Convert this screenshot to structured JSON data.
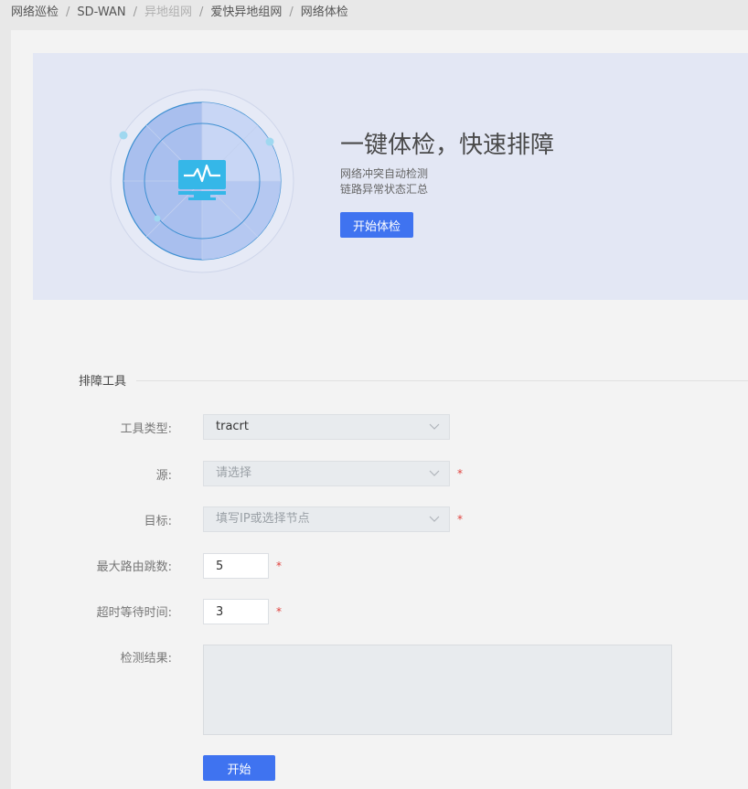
{
  "breadcrumb": [
    {
      "label": "网络巡检",
      "disabled": false
    },
    {
      "label": "SD-WAN",
      "disabled": false
    },
    {
      "label": "异地组网",
      "disabled": true
    },
    {
      "label": "爱快异地组网",
      "disabled": false
    },
    {
      "label": "网络体检",
      "disabled": false
    }
  ],
  "hero": {
    "title": "一键体检，快速排障",
    "line1": "网络冲突自动检测",
    "line2": "链路异常状态汇总",
    "button": "开始体检"
  },
  "tools": {
    "section_title": "排障工具",
    "tool_type": {
      "label": "工具类型:",
      "value": "tracrt"
    },
    "source": {
      "label": "源:",
      "placeholder": "请选择",
      "required": "*"
    },
    "target": {
      "label": "目标:",
      "placeholder": "填写IP或选择节点",
      "required": "*"
    },
    "max_hops": {
      "label": "最大路由跳数:",
      "value": "5",
      "required": "*"
    },
    "timeout": {
      "label": "超时等待时间:",
      "value": "3",
      "required": "*"
    },
    "result": {
      "label": "检测结果:"
    },
    "start_button": "开始"
  },
  "colors": {
    "primary": "#3f73f0",
    "hero_bg": "#e3e7f4",
    "required": "#e0413c",
    "monitor": "#35b7e8"
  }
}
